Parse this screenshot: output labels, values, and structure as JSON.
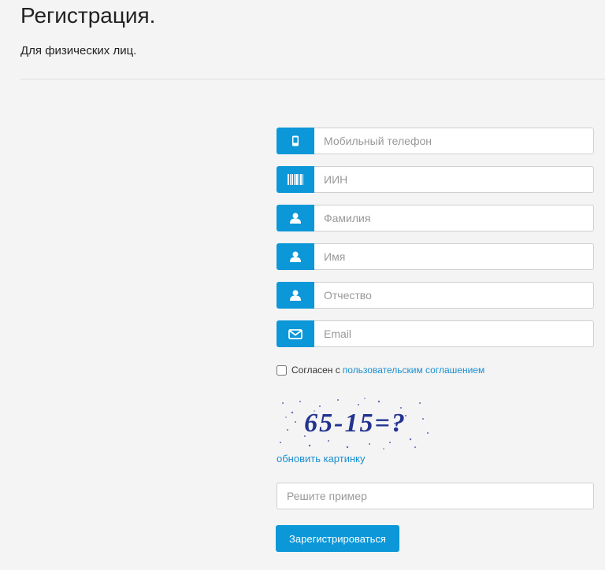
{
  "header": {
    "title": "Регистрация.",
    "subtitle": "Для физических лиц."
  },
  "form": {
    "fields": [
      {
        "icon": "mobile-phone-icon",
        "placeholder": "Мобильный телефон"
      },
      {
        "icon": "barcode-icon",
        "placeholder": "ИИН"
      },
      {
        "icon": "user-icon",
        "placeholder": "Фамилия"
      },
      {
        "icon": "user-icon",
        "placeholder": "Имя"
      },
      {
        "icon": "user-icon",
        "placeholder": "Отчество"
      },
      {
        "icon": "envelope-icon",
        "placeholder": "Email"
      }
    ],
    "agree_text": "Согласен с",
    "agree_link": "пользовательским соглашением",
    "captcha_text": "65-15=?",
    "refresh_link": "обновить картинку",
    "answer_placeholder": "Решите пример",
    "submit_label": "Зарегистрироваться"
  },
  "colors": {
    "accent": "#0b97d8",
    "link": "#1a8fd1",
    "background": "#f4f4f4"
  }
}
